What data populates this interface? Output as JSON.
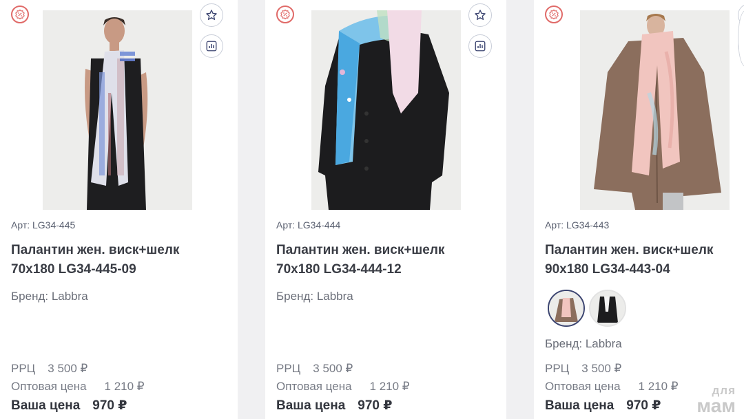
{
  "colors": {
    "badge": "#e06a68",
    "accent": "#3b4470",
    "background": "#f0f0f2"
  },
  "products": [
    {
      "article": "Арт: LG34-445",
      "title_line1": "Палантин жен. виск+шелк",
      "title_line2": "70х180 LG34-445-09",
      "brand": "Бренд: Labbra",
      "rrp_label": "РРЦ",
      "rrp_value": "3 500 ₽",
      "wholesale_label": "Оптовая цена",
      "wholesale_value": "1 210 ₽",
      "your_label": "Ваша цена",
      "your_value": "970 ₽",
      "badge_icon": "percent-badge-icon",
      "favorite_icon": "star-icon",
      "compare_icon": "bar-chart-icon"
    },
    {
      "article": "Арт: LG34-444",
      "title_line1": "Палантин жен. виск+шелк",
      "title_line2": "70х180 LG34-444-12",
      "brand": "Бренд: Labbra",
      "rrp_label": "РРЦ",
      "rrp_value": "3 500 ₽",
      "wholesale_label": "Оптовая цена",
      "wholesale_value": "1 210 ₽",
      "your_label": "Ваша цена",
      "your_value": "970 ₽",
      "badge_icon": "percent-badge-icon",
      "favorite_icon": "star-icon",
      "compare_icon": "bar-chart-icon"
    },
    {
      "article": "Арт: LG34-443",
      "title_line1": "Палантин жен. виск+шелк",
      "title_line2": "90х180 LG34-443-04",
      "brand": "Бренд: Labbra",
      "rrp_label": "РРЦ",
      "rrp_value": "3 500 ₽",
      "wholesale_label": "Оптовая цена",
      "wholesale_value": "1 210 ₽",
      "your_label": "Ваша цена",
      "your_value": "970 ₽",
      "badge_icon": "percent-badge-icon",
      "favorite_icon": "star-icon",
      "compare_icon": "bar-chart-icon"
    }
  ],
  "watermark": {
    "line1": "для",
    "line2": "мам"
  }
}
